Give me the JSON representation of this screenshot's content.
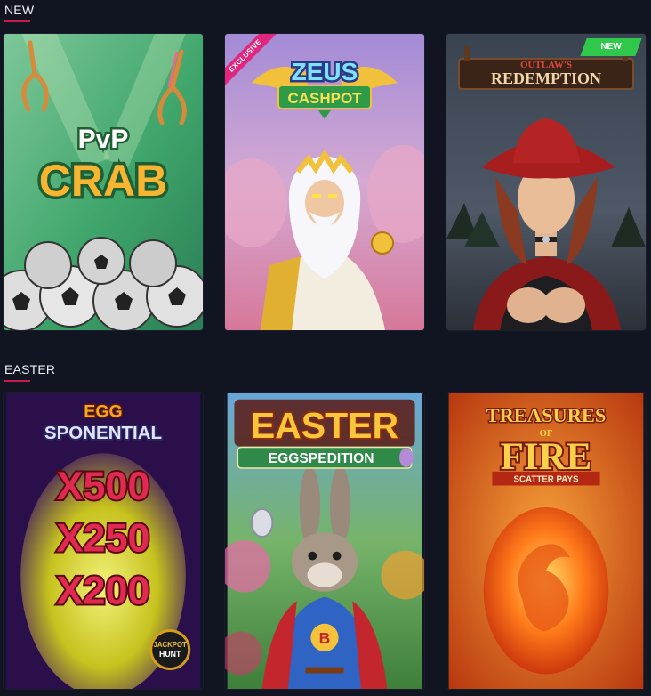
{
  "sections": [
    {
      "title": "NEW",
      "games": [
        {
          "title_line1": "PvP",
          "title_line2": "CRAB"
        },
        {
          "title_line1": "ZEUS",
          "title_line2": "CASHPOT",
          "ribbon": "EXCLUSIVE"
        },
        {
          "title_line1": "OUTLAW'S",
          "title_line2": "REDEMPTION",
          "badge": "NEW"
        }
      ]
    },
    {
      "title": "EASTER",
      "games": [
        {
          "title_line1": "EGG",
          "title_line2": "SPONENTIAL",
          "mult1": "X500",
          "mult2": "X250",
          "mult3": "X200",
          "logo_line1": "JACKPOT",
          "logo_line2": "HUNT"
        },
        {
          "title_line1": "EASTER",
          "title_line2": "EGGSPEDITION",
          "emblem": "B"
        },
        {
          "title_line1": "TREASURES",
          "title_line2": "OF",
          "title_line3": "FIRE",
          "subtitle": "SCATTER PAYS"
        }
      ]
    }
  ],
  "colors": {
    "background": "#111522",
    "accent": "#c81d4b",
    "badge_new": "#2fc84a",
    "ribbon_exclusive": "#e0267d"
  }
}
